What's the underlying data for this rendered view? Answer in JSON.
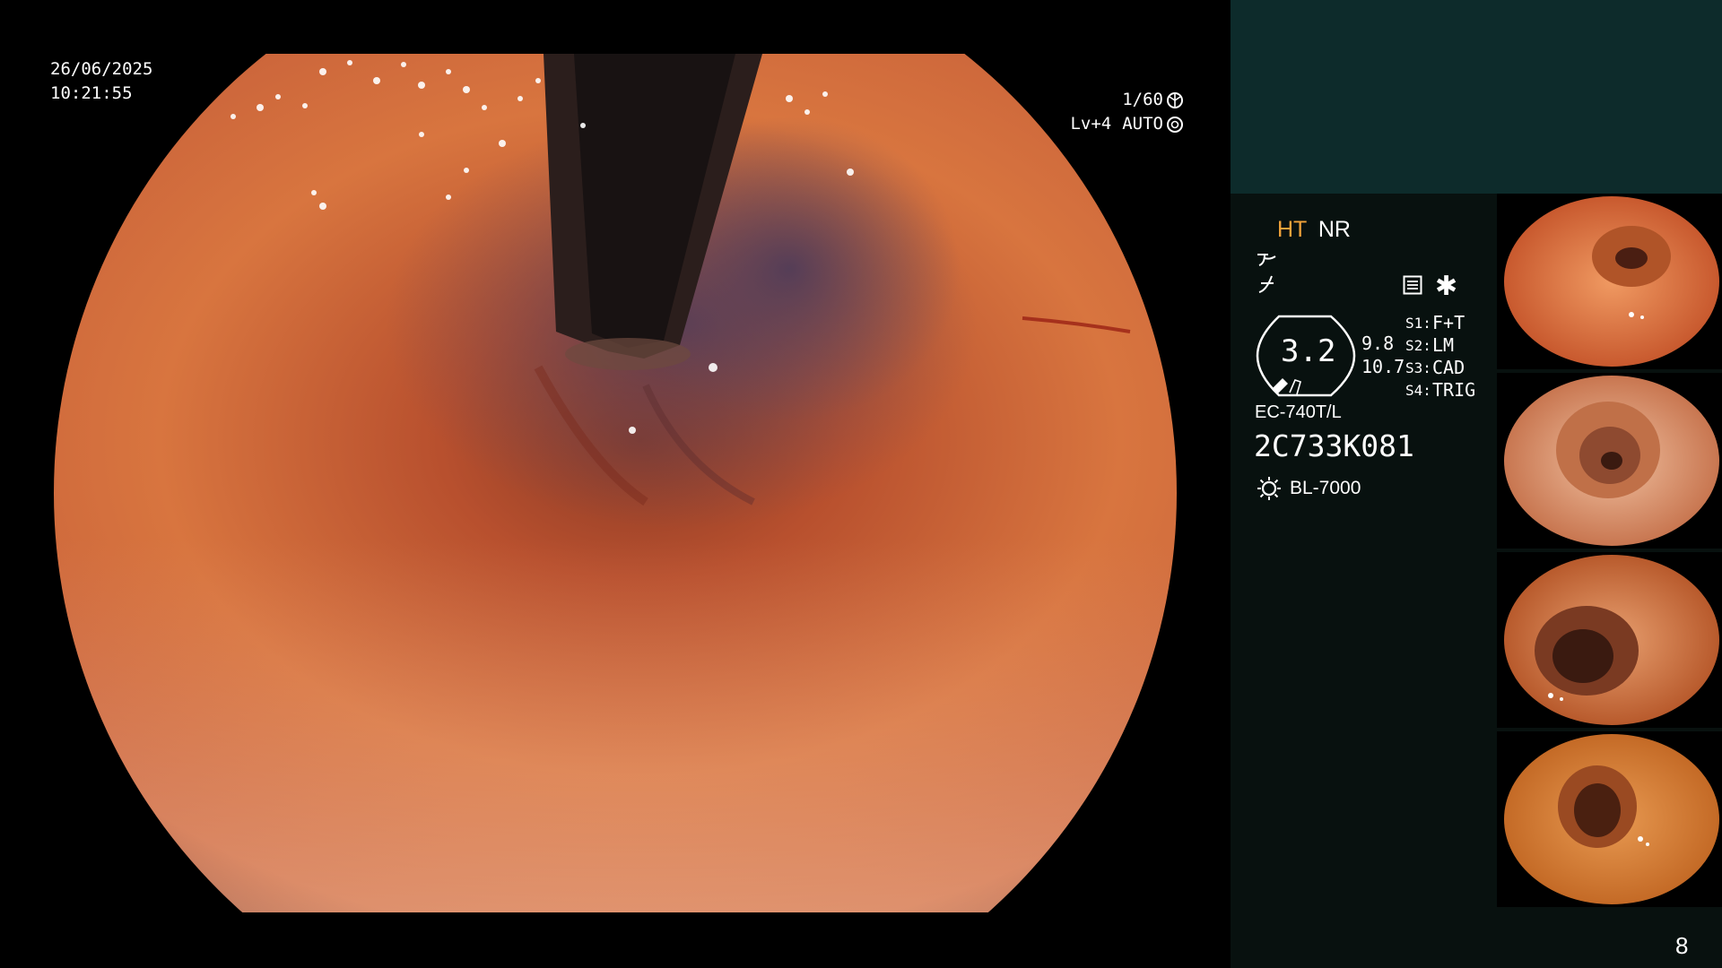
{
  "osd": {
    "date": "26/06/2025",
    "time": "10:21:55",
    "shutter": "1/60",
    "iris_level": "Lv+4",
    "iris_mode": "AUTO"
  },
  "panel": {
    "mode_ht": "HT",
    "mode_nr": "NR",
    "zoom_value": "3.2",
    "value_1": "9.8",
    "value_2": "10.7",
    "scope_switches": [
      {
        "key": "S1:",
        "value": "F+T"
      },
      {
        "key": "S2:",
        "value": "LM"
      },
      {
        "key": "S3:",
        "value": "CAD"
      },
      {
        "key": "S4:",
        "value": "TRIG"
      }
    ],
    "scope_model": "EC-740T/L",
    "scope_serial": "2C733K081",
    "light_source": "BL-7000",
    "page_number": "8"
  },
  "thumbnails": [
    {
      "label": "thumbnail-1"
    },
    {
      "label": "thumbnail-2"
    },
    {
      "label": "thumbnail-3"
    },
    {
      "label": "thumbnail-4"
    }
  ],
  "colors": {
    "panel_top": "#0d2b2b",
    "panel_bg": "#08110f",
    "accent_ht": "#f2a33a",
    "mucosa": "#d26a3c"
  }
}
